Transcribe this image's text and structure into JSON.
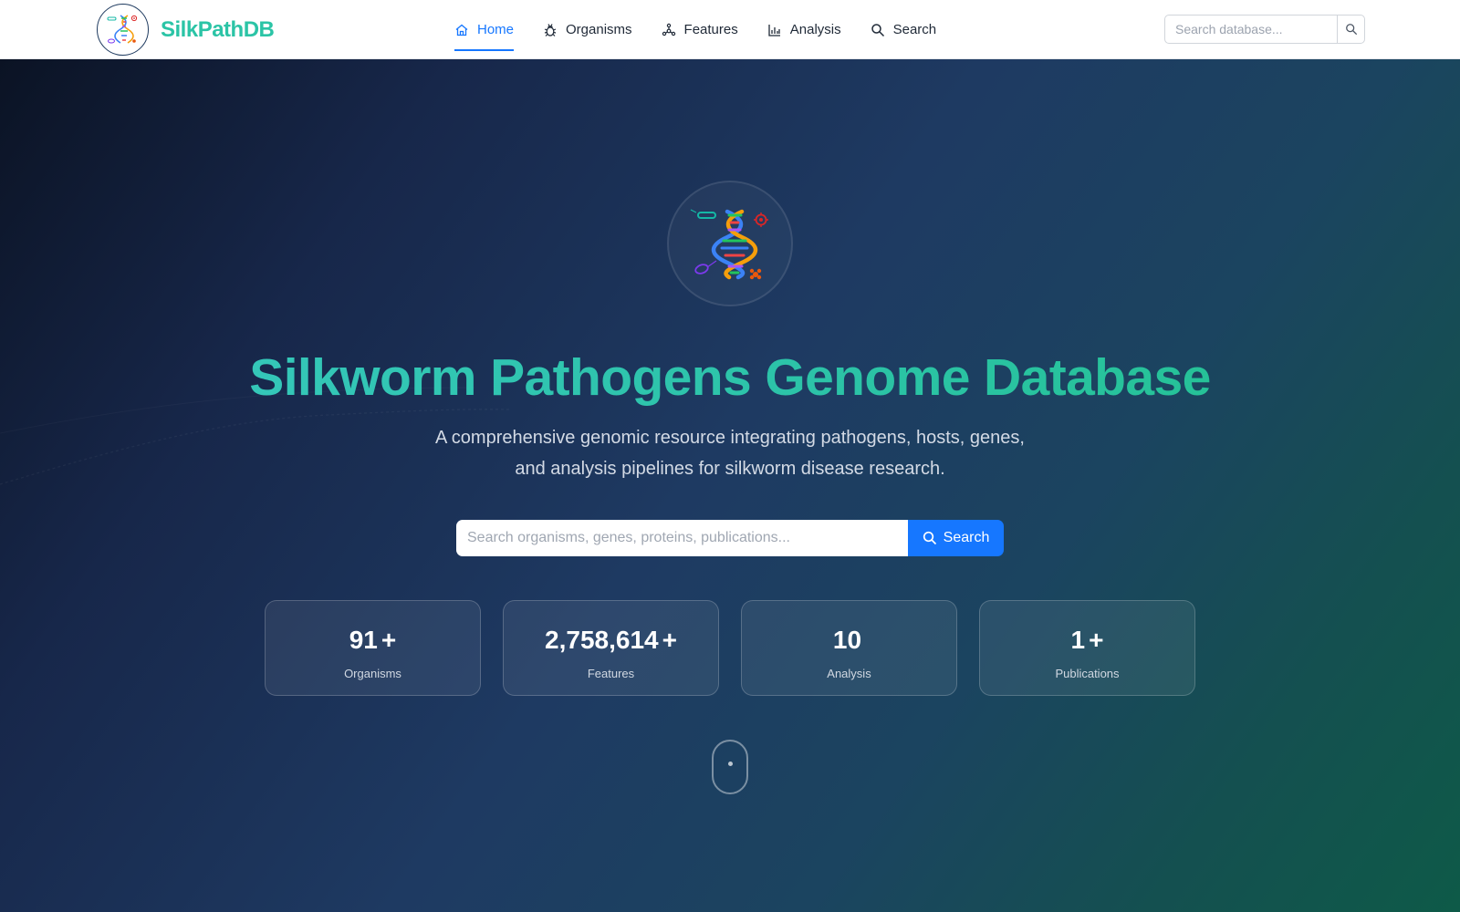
{
  "brand": {
    "name": "SilkPathDB",
    "logo_icon": "dna-pathogen-logo-icon",
    "color": "#2bc4a6"
  },
  "nav": {
    "items": [
      {
        "label": "Home",
        "icon": "home-icon",
        "active": true
      },
      {
        "label": "Organisms",
        "icon": "bug-icon",
        "active": false
      },
      {
        "label": "Features",
        "icon": "nodes-icon",
        "active": false
      },
      {
        "label": "Analysis",
        "icon": "bar-chart-icon",
        "active": false
      },
      {
        "label": "Search",
        "icon": "search-icon",
        "active": false
      }
    ],
    "active_color": "#1677ff"
  },
  "header_search": {
    "placeholder": "Search database...",
    "button_icon": "search-icon"
  },
  "hero": {
    "logo_icon": "dna-pathogen-logo-icon",
    "title": "Silkworm Pathogens Genome Database",
    "subtitle_line1": "A comprehensive genomic resource integrating pathogens, hosts, genes,",
    "subtitle_line2": "and analysis pipelines for silkworm disease research.",
    "search": {
      "placeholder": "Search organisms, genes, proteins, publications...",
      "button_label": "Search",
      "button_icon": "search-icon",
      "button_color": "#1677ff"
    }
  },
  "stats": [
    {
      "value": "91",
      "suffix": "+",
      "label": "Organisms"
    },
    {
      "value": "2,758,614",
      "suffix": "+",
      "label": "Features"
    },
    {
      "value": "10",
      "suffix": "",
      "label": "Analysis"
    },
    {
      "value": "1",
      "suffix": "+",
      "label": "Publications"
    }
  ],
  "scroll_indicator": {
    "icon": "mouse-scroll-icon"
  }
}
